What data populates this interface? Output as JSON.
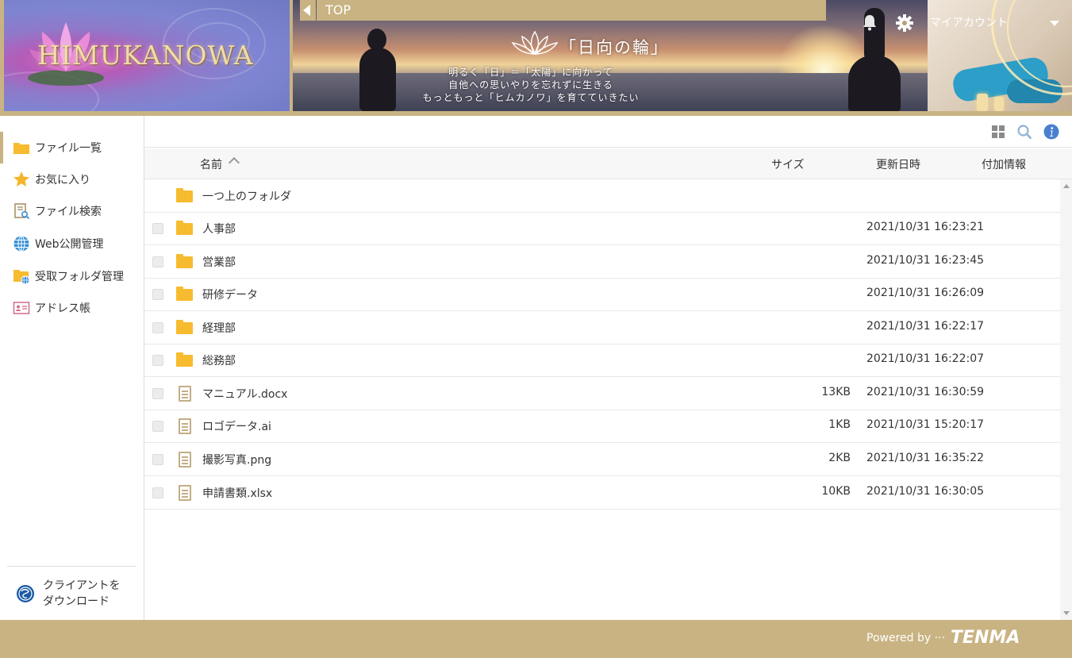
{
  "header": {
    "logo_text": "HIMUKANOWA",
    "banner_title": "「日向の輪」",
    "banner_lines": [
      "明るく「日」＝「太陽」に向かって",
      "自他への思いやりを忘れずに生きる",
      "もっともっと「ヒムカノワ」を育てていきたい"
    ],
    "nav_label": "TOP",
    "account_label": "マイアカウント"
  },
  "sidebar": {
    "items": [
      {
        "label": "ファイル一覧",
        "icon": "folder-icon"
      },
      {
        "label": "お気に入り",
        "icon": "star-icon"
      },
      {
        "label": "ファイル検索",
        "icon": "file-search-icon"
      },
      {
        "label": "Web公開管理",
        "icon": "globe-icon"
      },
      {
        "label": "受取フォルダ管理",
        "icon": "receive-folder-icon"
      },
      {
        "label": "アドレス帳",
        "icon": "address-book-icon"
      }
    ],
    "client_download": {
      "line1": "クライアントを",
      "line2": "ダウンロード"
    }
  },
  "list": {
    "columns": {
      "name": "名前",
      "size": "サイズ",
      "updated": "更新日時",
      "info": "付加情報"
    },
    "parent_folder": "一つ上のフォルダ",
    "rows": [
      {
        "name": "人事部",
        "type": "folder",
        "size": "",
        "date": "2021/10/31 16:23:21"
      },
      {
        "name": "営業部",
        "type": "folder",
        "size": "",
        "date": "2021/10/31 16:23:45"
      },
      {
        "name": "研修データ",
        "type": "folder",
        "size": "",
        "date": "2021/10/31 16:26:09"
      },
      {
        "name": "経理部",
        "type": "folder",
        "size": "",
        "date": "2021/10/31 16:22:17"
      },
      {
        "name": "総務部",
        "type": "folder",
        "size": "",
        "date": "2021/10/31 16:22:07"
      },
      {
        "name": "マニュアル.docx",
        "type": "file",
        "size": "13KB",
        "date": "2021/10/31 16:30:59"
      },
      {
        "name": "ロゴデータ.ai",
        "type": "file",
        "size": "1KB",
        "date": "2021/10/31 15:20:17"
      },
      {
        "name": "撮影写真.png",
        "type": "file",
        "size": "2KB",
        "date": "2021/10/31 16:35:22"
      },
      {
        "name": "申請書類.xlsx",
        "type": "file",
        "size": "10KB",
        "date": "2021/10/31 16:30:05"
      }
    ]
  },
  "footer": {
    "powered_by": "Powered by ···",
    "brand": "TENMA"
  },
  "colors": {
    "accent": "#c9b383",
    "folder": "#f7bb2f",
    "file": "#c4ad86",
    "info": "#4a7fd0"
  }
}
